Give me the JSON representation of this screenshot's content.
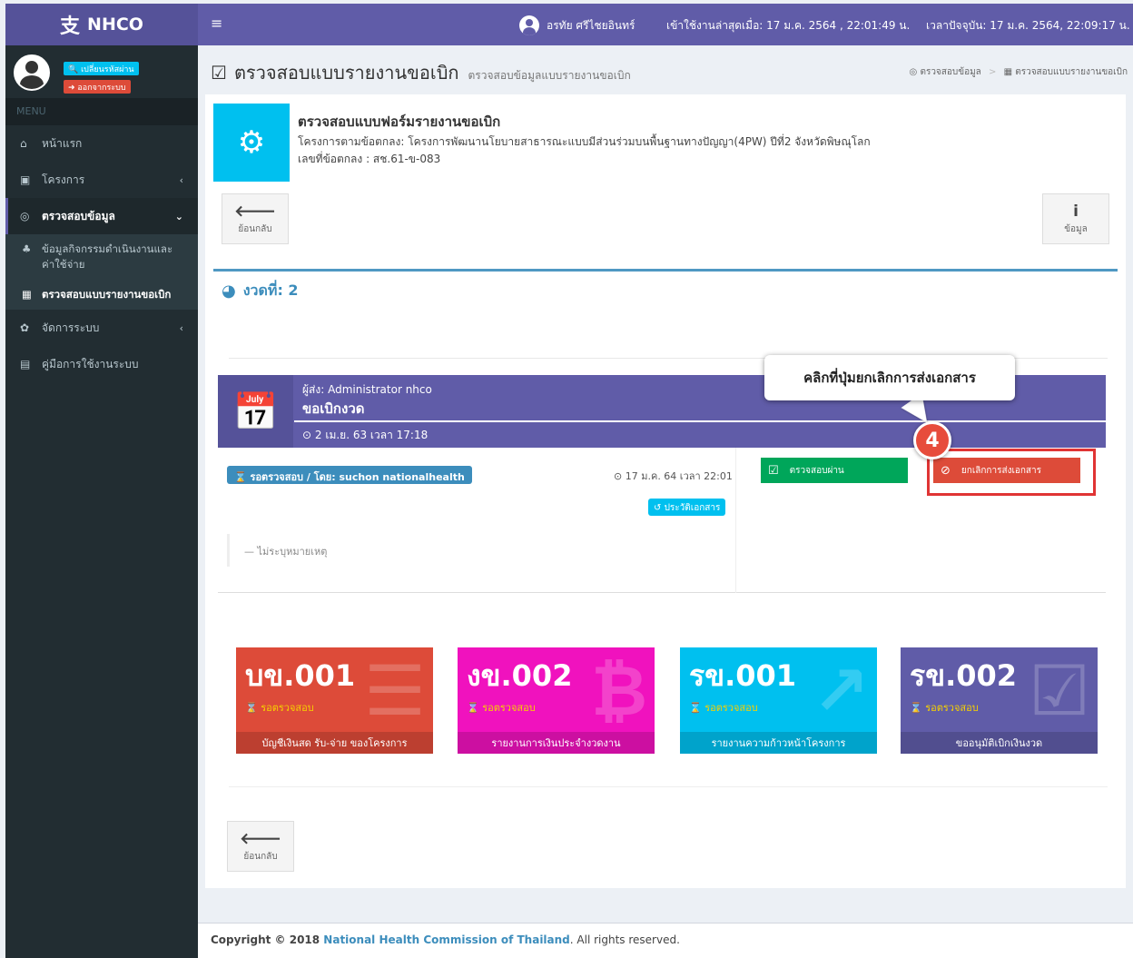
{
  "header": {
    "logo_mark": "⽀",
    "brand": "NHCO",
    "menu_icon": "≡",
    "user_name": "อรทัย ศรีไชยอินทร์",
    "last_login": "เข้าใช้งานล่าสุดเมื่อ: 17 ม.ค. 2564 , 22:01:49 น.",
    "current_time": "เวลาปัจจุบัน: 17 ม.ค. 2564, 22:09:17 น."
  },
  "sidebar": {
    "change_password": "เปลี่ยนรหัสผ่าน",
    "logout": "ออกจากระบบ",
    "menu_header": "MENU",
    "items": [
      {
        "label": "หน้าแรก",
        "icon": "home-icon"
      },
      {
        "label": "โครงการ",
        "icon": "project-icon"
      },
      {
        "label": "ตรวจสอบข้อมูล",
        "icon": "binoculars-icon"
      },
      {
        "label": "จัดการระบบ",
        "icon": "gear-icon"
      },
      {
        "label": "คู่มือการใช้งานระบบ",
        "icon": "document-icon"
      }
    ],
    "sub_items": [
      {
        "label": "ข้อมูลกิจกรรมดำเนินงานและค่าใช้จ่าย"
      },
      {
        "label": "ตรวจสอบแบบรายงานขอเบิก"
      }
    ]
  },
  "page": {
    "title": "ตรวจสอบแบบรายงานขอเบิก",
    "subtitle": "ตรวจสอบข้อมูลแบบรายงานขอเบิก",
    "breadcrumb": [
      "ตรวจสอบข้อมูล",
      "ตรวจสอบแบบรายงานขอเบิก"
    ]
  },
  "info": {
    "title": "ตรวจสอบแบบฟอร์มรายงานขอเบิก",
    "project": "โครงการตามข้อตกลง: โครงการพัฒนานโยบายสาธารณะแบบมีส่วนร่วมบนพื้นฐานทางปัญญา(4PW) ปีที่2 จังหวัดพิษณุโลก",
    "agreement": "เลขที่ข้อตกลง : สช.61-ข-083"
  },
  "toolbar": {
    "back_label": "ย้อนกลับ",
    "info_label": "ข้อมูล"
  },
  "installment": {
    "label": "งวดที่: 2"
  },
  "timeline": {
    "sender": "ผู้ส่ง: Administrator nhco",
    "type": "ขอเบิกงวด",
    "sent_date": "2 เม.ย. 63 เวลา 17:18",
    "status_badge": "รอตรวจสอบ / โดย: suchon nationalhealth",
    "status_time": "17 ม.ค. 64 เวลา 22:01",
    "history_button": "ประวัติเอกสาร",
    "note": "— ไม่ระบุหมายเหตุ",
    "pass_button": "ตรวจสอบผ่าน",
    "cancel_button": "ยกเลิกการส่งเอกสาร"
  },
  "callout": {
    "text": "คลิกที่ปุ่มยกเลิกการส่งเอกสาร",
    "step": "4"
  },
  "tiles": [
    {
      "code": "บข.001",
      "status": "รอตรวจสอบ",
      "label": "บัญชีเงินสด รับ-จ่าย ของโครงการ",
      "color": "#dd4b39"
    },
    {
      "code": "งข.002",
      "status": "รอตรวจสอบ",
      "label": "รายงานการเงินประจำงวดงาน",
      "color": "#f012be"
    },
    {
      "code": "รข.001",
      "status": "รอตรวจสอบ",
      "label": "รายงานความก้าวหน้าโครงการ",
      "color": "#00c0ef"
    },
    {
      "code": "รข.002",
      "status": "รอตรวจสอบ",
      "label": "ขออนุมัติเบิกเงินงวด",
      "color": "#605ca8"
    }
  ],
  "footer": {
    "copyright": "Copyright © 2018 ",
    "org": "National Health Commission of Thailand",
    "rights": ". All rights reserved."
  }
}
